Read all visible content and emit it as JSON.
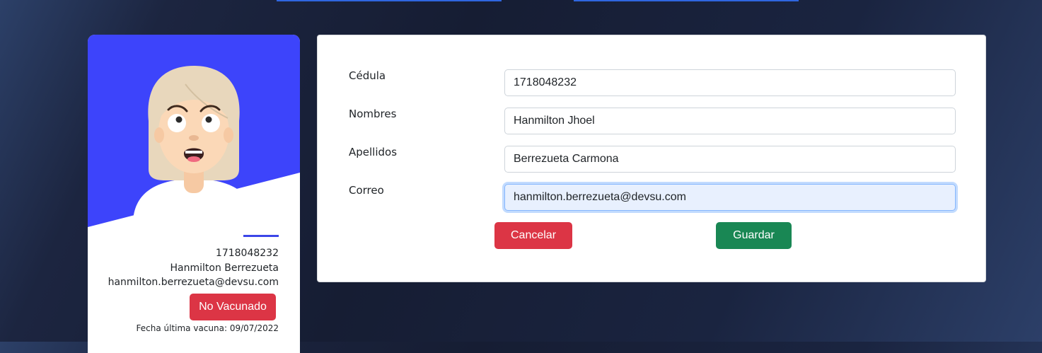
{
  "profile": {
    "id_number": "1718048232",
    "full_name": "Hanmilton Berrezueta",
    "email": "hanmilton.berrezueta@devsu.com",
    "status_label": "No Vacunado",
    "last_vaccine": "Fecha última vacuna: 09/07/2022",
    "accent_color": "#3d44fb",
    "status_color": "#dc3545"
  },
  "form": {
    "fields": [
      {
        "label": "Cédula",
        "value": "1718048232"
      },
      {
        "label": "Nombres",
        "value": "Hanmilton Jhoel"
      },
      {
        "label": "Apellidos",
        "value": "Berrezueta Carmona"
      },
      {
        "label": "Correo",
        "value": "hanmilton.berrezueta@devsu.com"
      }
    ],
    "cancel_label": "Cancelar",
    "save_label": "Guardar",
    "cancel_color": "#dc3545",
    "save_color": "#198754"
  }
}
